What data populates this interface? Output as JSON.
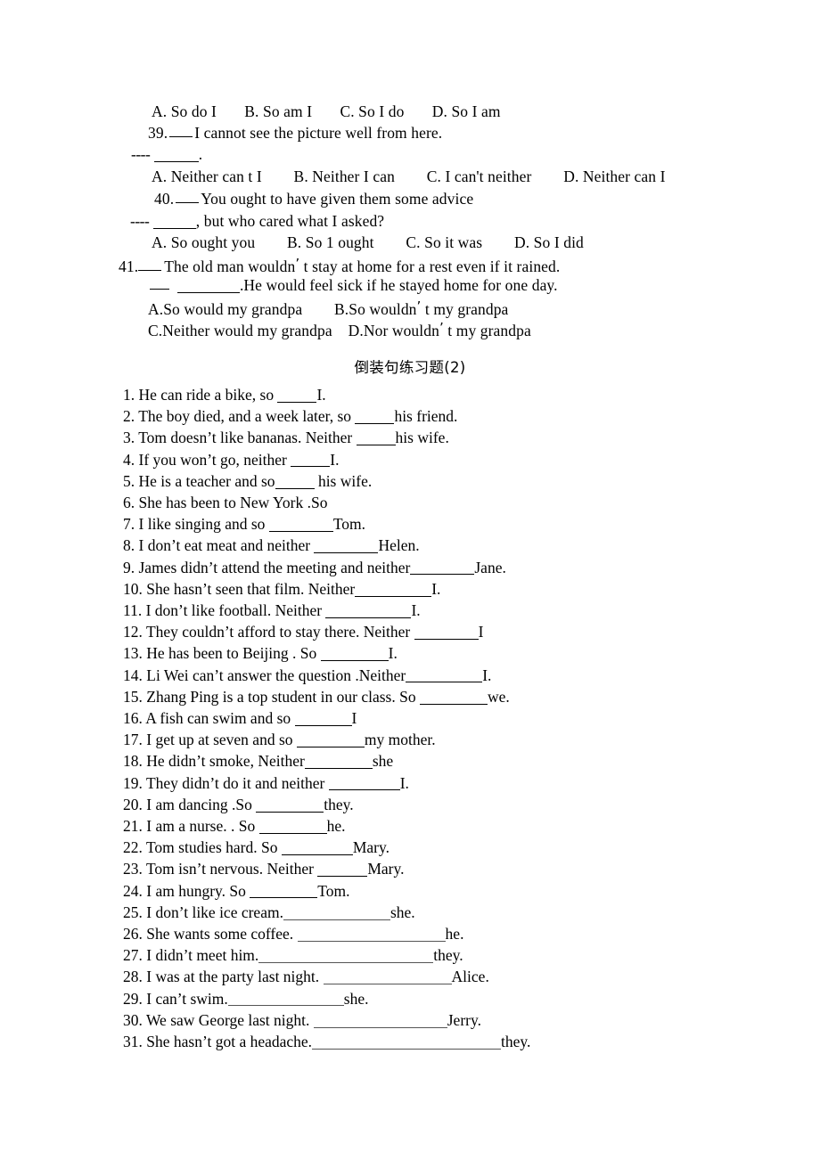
{
  "document": {
    "heading": "倒装句练习题(2)",
    "background_color": "#ffffff",
    "text_color": "#000000"
  },
  "multiple_choice": {
    "q38_options": "A. So do I       B. So am I       C. So I do       D. So I am",
    "questions": [
      {
        "number": "39.",
        "speaker_dash": "——",
        "stem": "I cannot see the picture well from here.",
        "reply_dash": "----",
        "reply_blank_suffix": ".",
        "options": "A. Neither can t I        B. Neither I can        C. I can't neither        D. Neither can I"
      },
      {
        "number": "40.",
        "speaker_dash": "——",
        "stem": "You ought to have given them some advice",
        "reply_dash": "----",
        "reply_blank_suffix": ", but who cared what I asked?",
        "options": "A. So ought you        B. So 1 ought        C. So it was        D. So I did"
      },
      {
        "number": "41.",
        "speaker_dash": "——",
        "stem_before_apos": "The old man wouldn",
        "stem_after_apos": " t stay at home for a rest even if it rained.",
        "reply_dash": "——",
        "reply_blank_suffix": ".He would feel sick if he stayed home for one day.",
        "options_row1_a": "A.So would my grandpa",
        "options_row1_b_before": "B.So wouldn",
        "options_row1_b_after": " t my grandpa",
        "options_row2_c": "C.Neither would my grandpa",
        "options_row2_d_before": "D.Nor wouldn",
        "options_row2_d_after": " t my grandpa"
      }
    ]
  },
  "exercises": [
    {
      "num": "1.",
      "before": "He can ride a bike, so ",
      "blank": 44,
      "after": "I."
    },
    {
      "num": "2.",
      "before": "The boy died, and a week later, so ",
      "blank": 44,
      "after": "his friend."
    },
    {
      "num": "3.",
      "before": "Tom doesn’t like bananas. Neither ",
      "blank": 44,
      "after": "his wife."
    },
    {
      "num": "4.",
      "before": "If you won’t go, neither ",
      "blank": 44,
      "after": "I."
    },
    {
      "num": "5.",
      "before": "He is a teacher and so",
      "blank": 44,
      "after": " his wife."
    },
    {
      "num": "6.",
      "before": "She has been to New York .So",
      "blank": 0,
      "after": ""
    },
    {
      "num": "7.",
      "before": "I like singing and so ",
      "blank": 72,
      "after": "Tom."
    },
    {
      "num": "8.",
      "before": "I don’t eat meat and neither ",
      "blank": 72,
      "after": "Helen."
    },
    {
      "num": "9.",
      "before": "James didn’t attend the meeting and neither",
      "blank": 72,
      "after": "Jane."
    },
    {
      "num": "10.",
      "before": "She hasn’t seen that film. Neither",
      "blank": 86,
      "after": "I."
    },
    {
      "num": "11.",
      "before": "I don’t like football. Neither ",
      "blank": 96,
      "after": "I."
    },
    {
      "num": "12.",
      "before": "They couldn’t afford to stay there. Neither ",
      "blank": 72,
      "after": "I"
    },
    {
      "num": "13.",
      "before": "He has been to Beijing . So ",
      "blank": 76,
      "after": "I."
    },
    {
      "num": "14.",
      "before": "Li Wei can’t answer the question .Neither",
      "blank": 86,
      "after": "I."
    },
    {
      "num": "15.",
      "before": "Zhang Ping is a top student in our class. So ",
      "blank": 76,
      "after": "we."
    },
    {
      "num": "16.",
      "before": "A fish can swim and so ",
      "blank": 64,
      "after": "I"
    },
    {
      "num": "17.",
      "before": "I get up at seven and so ",
      "blank": 76,
      "after": "my mother."
    },
    {
      "num": "18.",
      "before": "He didn’t smoke, Neither",
      "blank": 76,
      "after": "she"
    },
    {
      "num": "19.",
      "before": "They didn’t do it and neither ",
      "blank": 80,
      "after": "I."
    },
    {
      "num": "20.",
      "before": "I am dancing .So ",
      "blank": 76,
      "after": "they."
    },
    {
      "num": "21.",
      "before": "I am a nurse. . So ",
      "blank": 76,
      "after": "he."
    },
    {
      "num": "22.",
      "before": "Tom studies hard. So ",
      "blank": 80,
      "after": "Mary."
    },
    {
      "num": "23.",
      "before": "Tom isn’t nervous. Neither ",
      "blank": 56,
      "after": "Mary."
    },
    {
      "num": "24.",
      "before": "I am hungry. So ",
      "blank": 76,
      "after": "Tom."
    },
    {
      "num": "25.",
      "before": "I don’t like ice cream.",
      "blank": 120,
      "after": "she."
    },
    {
      "num": "26.",
      "before": "She wants some coffee. ",
      "blank": 166,
      "after": "he."
    },
    {
      "num": "27.",
      "before": "I didn’t meet him.",
      "blank": 196,
      "after": "they."
    },
    {
      "num": "28.",
      "before": "I was at the party last night. ",
      "blank": 144,
      "after": "Alice."
    },
    {
      "num": "29.",
      "before": "I can’t swim.",
      "blank": 130,
      "after": "she."
    },
    {
      "num": "30.",
      "before": "We saw George last night. ",
      "blank": 150,
      "after": "Jerry."
    },
    {
      "num": "31.",
      "before": "She hasn’t got a headache.",
      "blank": 212,
      "after": "they."
    }
  ]
}
